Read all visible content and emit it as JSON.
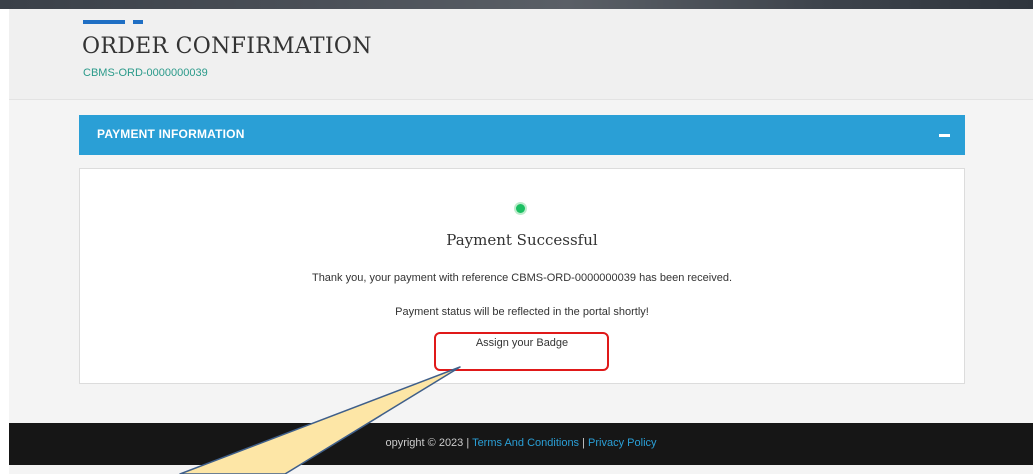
{
  "header": {
    "title": "ORDER CONFIRMATION",
    "order_ref": "CBMS-ORD-0000000039"
  },
  "panel": {
    "title": "PAYMENT INFORMATION",
    "status_title": "Payment Successful",
    "message": "Thank you, your payment with reference CBMS-ORD-0000000039 has been received.",
    "note": "Payment status will be reflected in the portal shortly!",
    "assign_link": "Assign your Badge"
  },
  "footer": {
    "copyright": "opyright © 2023 | ",
    "terms": "Terms And Conditions",
    "separator": " | ",
    "privacy": "Privacy Policy"
  },
  "colors": {
    "accent": "#2a9fd6",
    "success": "#1bbf62",
    "highlight": "#e01919",
    "callout_fill": "#fde6a6",
    "callout_stroke": "#3f5f8a"
  },
  "icons": {
    "collapse": "minus-icon",
    "status": "success-dot-icon"
  }
}
